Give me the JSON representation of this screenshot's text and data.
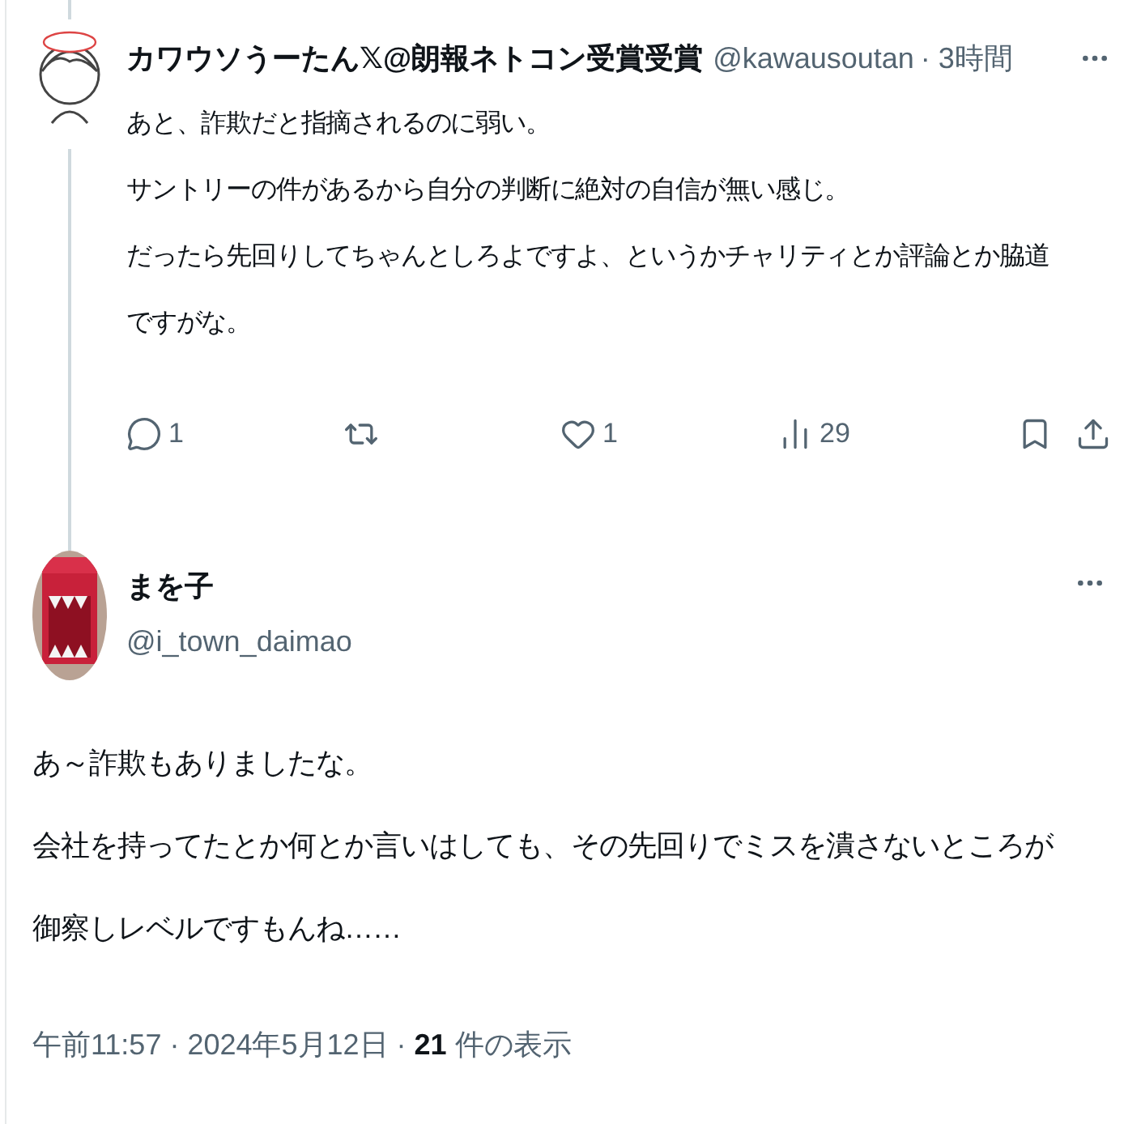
{
  "reply_to": {
    "name": "カワウソうーたん𝕏@朗報ネトコン受賞受賞",
    "handle": "@kawausoutan",
    "time": "· 3時間",
    "lines": [
      "あと、詐欺だと指摘されるのに弱い。",
      "サントリーの件があるから自分の判断に絶対の自信が無い感じ。",
      "だったら先回りしてちゃんとしろよですよ、というかチャリティとか評論とか脇道",
      "ですがな。"
    ],
    "actions": [
      {
        "kind": "reply",
        "count": "1"
      },
      {
        "kind": "repost"
      },
      {
        "kind": "like",
        "count": "1"
      },
      {
        "kind": "views",
        "count": "29"
      }
    ]
  },
  "tweet": {
    "name": "まを子",
    "handle": "@i_town_daimao",
    "lines": [
      "あ～詐欺もありましたな。",
      "会社を持ってたとか何とか言いはしても、その先回りでミスを潰さないところが",
      "御察しレベルですもんね……"
    ],
    "meta": "午前11:57 · 2024年5月12日 · **21** 件の表示"
  }
}
